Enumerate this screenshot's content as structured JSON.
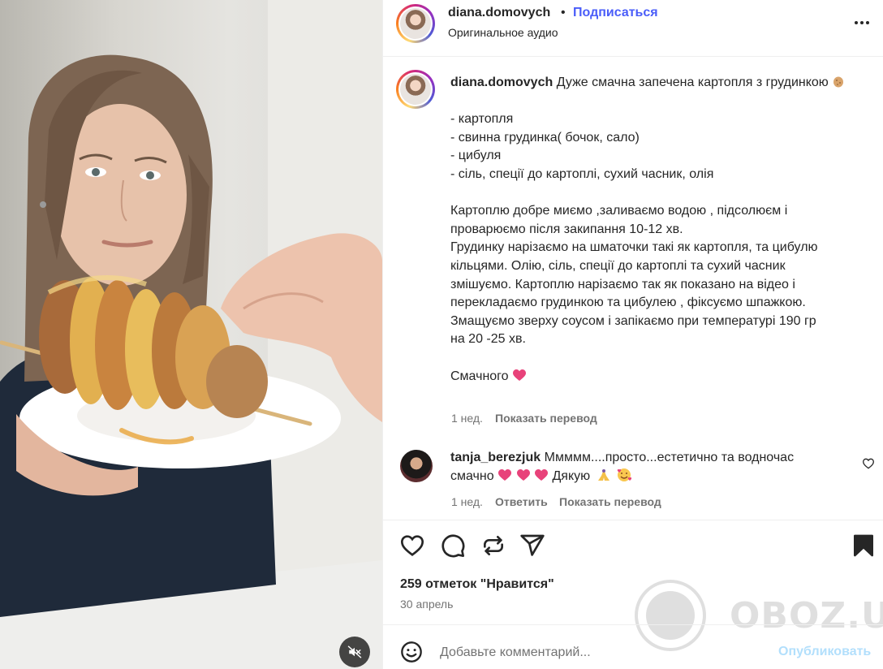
{
  "media": {
    "mute_icon": "speaker-muted-icon"
  },
  "header": {
    "username": "diana.domovych",
    "separator": "•",
    "follow_label": "Подписаться",
    "audio_label": "Оригинальное аудио",
    "more_icon": "more-options-icon"
  },
  "caption": {
    "username": "diana.domovych",
    "title": "Дуже смачна запечена картопля з грудинкою",
    "title_emoji": "potato-emoji",
    "ingredients": [
      "- картопля",
      "- свинна грудинка( бочок, сало)",
      "- цибуля",
      "- сіль, спеції до картоплі, сухий часник, олія"
    ],
    "steps": [
      "Картоплю добре миємо ,заливаємо водою , підсолюєм і",
      "проварюємо після закипання 10-12 хв.",
      "Грудинку нарізаємо на шматочки такі як картопля, та цибулю",
      "кільцями. Олію, сіль, спеції до картоплі та сухий часник",
      "змішуємо. Картоплю нарізаємо так як показано на відео і",
      "перекладаємо грудинкою та цибулею , фіксуємо шпажкою.",
      "Змащуємо зверху соусом і запікаємо при температурі 190 гр",
      "на 20 -25 хв."
    ],
    "closing": "Смачного",
    "closing_emoji": "pink-heart-emoji",
    "time": "1 нед.",
    "translate_label": "Показать перевод"
  },
  "comment": {
    "username": "tanja_berezjuk",
    "text_line1": "Ммммм....просто...естетично та водночас",
    "text_line2_prefix": "смачно",
    "text_line2_suffix": "Дякую",
    "emojis": [
      "pink-heart-emoji",
      "pink-heart-emoji",
      "pink-heart-emoji",
      "folded-hands-emoji",
      "smiling-face-with-hearts-emoji"
    ],
    "time": "1 нед.",
    "reply_label": "Ответить",
    "translate_label": "Показать перевод"
  },
  "actions": {
    "icons": [
      "heart-icon",
      "comment-icon",
      "repost-icon",
      "share-icon",
      "bookmark-icon"
    ]
  },
  "likes_text": "259 отметок \"Нравится\"",
  "date_text": "30 апрель",
  "add_comment": {
    "placeholder": "Добавьте комментарий...",
    "post_label": "Опубликовать",
    "emoji_icon": "emoji-smile-icon"
  },
  "watermark": {
    "text": "OBOZ.UA"
  },
  "colors": {
    "accent_blue": "#4a5df9",
    "post_button_disabled": "#b2dffc",
    "text_primary": "#262626",
    "text_secondary": "#737373",
    "heart_pink": "#e8427a"
  }
}
